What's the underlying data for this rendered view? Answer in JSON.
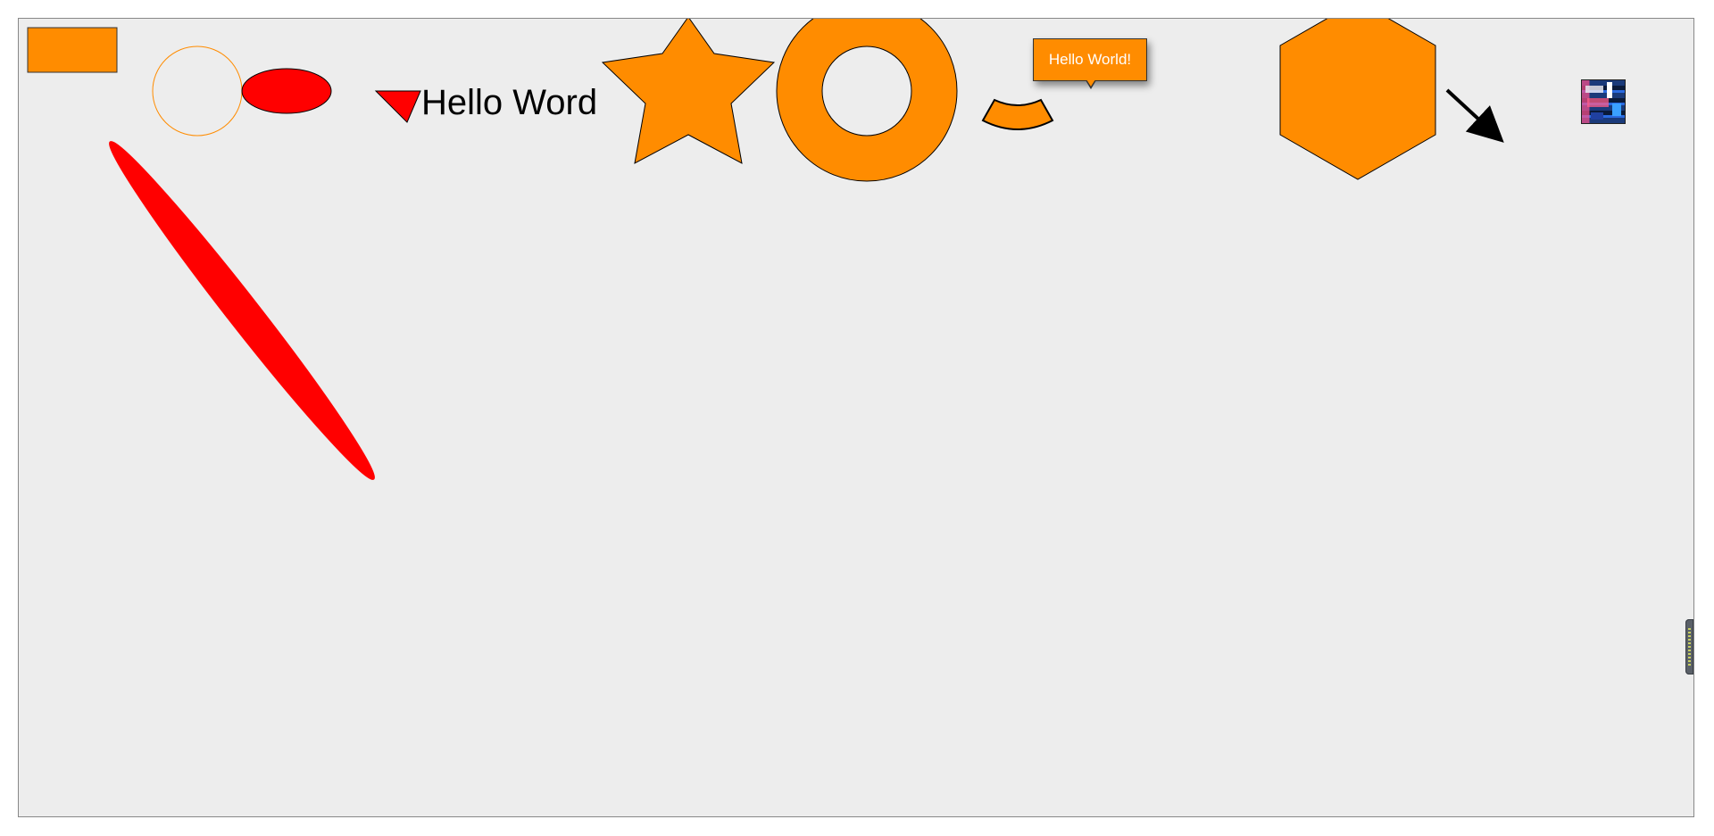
{
  "canvas": {
    "background_color": "#ededed",
    "border_color": "#888888"
  },
  "shapes": {
    "text": "Hello Word",
    "callout_text": "Hello World!",
    "colors": {
      "orange": "#ff8c00",
      "red": "#ff0000",
      "outline": "#000000",
      "circle_outline": "#ff8c00"
    }
  },
  "icons": {
    "arrow": "arrow-down-right-icon",
    "image": "image-thumbnail-icon",
    "handle": "scroll-handle-icon"
  }
}
